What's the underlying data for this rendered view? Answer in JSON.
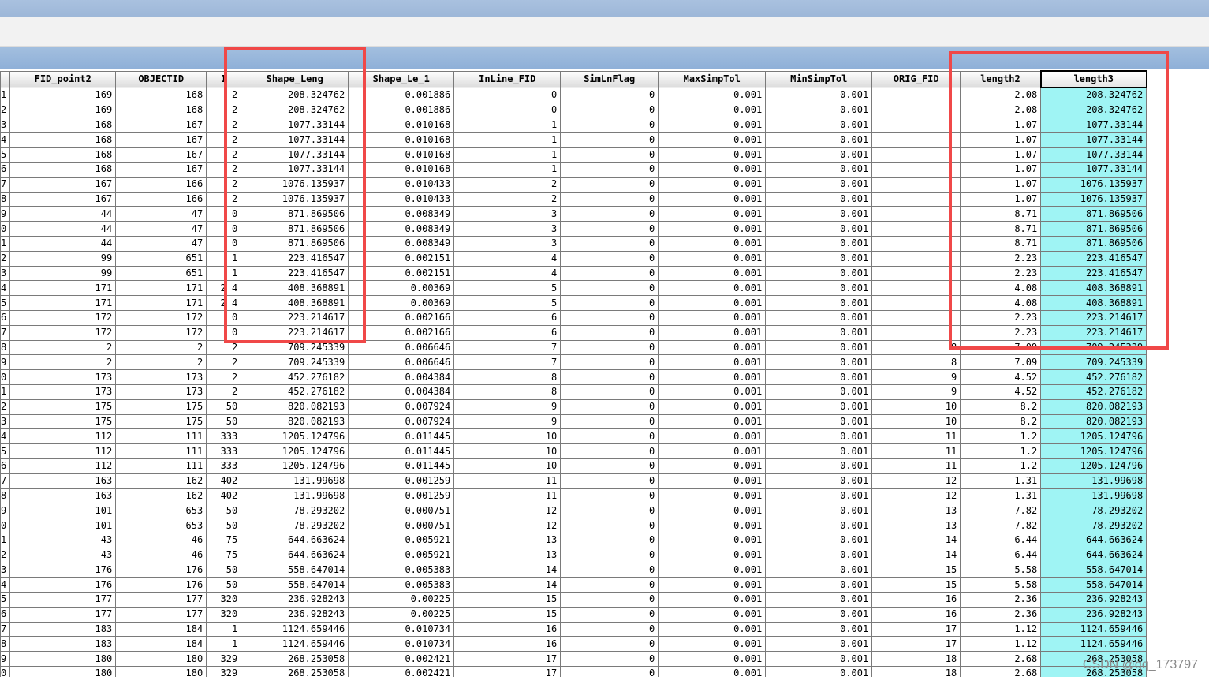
{
  "columns": [
    {
      "key": "rid",
      "label": ""
    },
    {
      "key": "fid_point2",
      "label": "FID_point2"
    },
    {
      "key": "objectid",
      "label": "OBJECTID"
    },
    {
      "key": "id",
      "label": "I"
    },
    {
      "key": "shape_leng",
      "label": "Shape_Leng"
    },
    {
      "key": "shape_le_1",
      "label": "Shape_Le_1"
    },
    {
      "key": "inline_fid",
      "label": "InLine_FID"
    },
    {
      "key": "simlnflag",
      "label": "SimLnFlag"
    },
    {
      "key": "maxsimptol",
      "label": "MaxSimpTol"
    },
    {
      "key": "minsimptol",
      "label": "MinSimpTol"
    },
    {
      "key": "orig_fid",
      "label": "ORIG_FID"
    },
    {
      "key": "length2",
      "label": "length2"
    },
    {
      "key": "length3",
      "label": "length3"
    }
  ],
  "rows": [
    [
      "1",
      "169",
      "168",
      "2",
      "208.324762",
      "0.001886",
      "0",
      "0",
      "0.001",
      "0.001",
      "",
      "2.08",
      "208.324762"
    ],
    [
      "2",
      "169",
      "168",
      "2",
      "208.324762",
      "0.001886",
      "0",
      "0",
      "0.001",
      "0.001",
      "",
      "2.08",
      "208.324762"
    ],
    [
      "3",
      "168",
      "167",
      "2",
      "1077.33144",
      "0.010168",
      "1",
      "0",
      "0.001",
      "0.001",
      "",
      "1.07",
      "1077.33144"
    ],
    [
      "4",
      "168",
      "167",
      "2",
      "1077.33144",
      "0.010168",
      "1",
      "0",
      "0.001",
      "0.001",
      "",
      "1.07",
      "1077.33144"
    ],
    [
      "5",
      "168",
      "167",
      "2",
      "1077.33144",
      "0.010168",
      "1",
      "0",
      "0.001",
      "0.001",
      "",
      "1.07",
      "1077.33144"
    ],
    [
      "6",
      "168",
      "167",
      "2",
      "1077.33144",
      "0.010168",
      "1",
      "0",
      "0.001",
      "0.001",
      "",
      "1.07",
      "1077.33144"
    ],
    [
      "7",
      "167",
      "166",
      "2",
      "1076.135937",
      "0.010433",
      "2",
      "0",
      "0.001",
      "0.001",
      "",
      "1.07",
      "1076.135937"
    ],
    [
      "8",
      "167",
      "166",
      "2",
      "1076.135937",
      "0.010433",
      "2",
      "0",
      "0.001",
      "0.001",
      "",
      "1.07",
      "1076.135937"
    ],
    [
      "9",
      "44",
      "47",
      "0",
      "871.869506",
      "0.008349",
      "3",
      "0",
      "0.001",
      "0.001",
      "",
      "8.71",
      "871.869506"
    ],
    [
      "0",
      "44",
      "47",
      "0",
      "871.869506",
      "0.008349",
      "3",
      "0",
      "0.001",
      "0.001",
      "",
      "8.71",
      "871.869506"
    ],
    [
      "1",
      "44",
      "47",
      "0",
      "871.869506",
      "0.008349",
      "3",
      "0",
      "0.001",
      "0.001",
      "",
      "8.71",
      "871.869506"
    ],
    [
      "2",
      "99",
      "651",
      "1",
      "223.416547",
      "0.002151",
      "4",
      "0",
      "0.001",
      "0.001",
      "",
      "2.23",
      "223.416547"
    ],
    [
      "3",
      "99",
      "651",
      "1",
      "223.416547",
      "0.002151",
      "4",
      "0",
      "0.001",
      "0.001",
      "",
      "2.23",
      "223.416547"
    ],
    [
      "4",
      "171",
      "171",
      "2 4",
      "408.368891",
      "0.00369",
      "5",
      "0",
      "0.001",
      "0.001",
      "",
      "4.08",
      "408.368891"
    ],
    [
      "5",
      "171",
      "171",
      "2 4",
      "408.368891",
      "0.00369",
      "5",
      "0",
      "0.001",
      "0.001",
      "",
      "4.08",
      "408.368891"
    ],
    [
      "6",
      "172",
      "172",
      "0",
      "223.214617",
      "0.002166",
      "6",
      "0",
      "0.001",
      "0.001",
      "",
      "2.23",
      "223.214617"
    ],
    [
      "7",
      "172",
      "172",
      "0",
      "223.214617",
      "0.002166",
      "6",
      "0",
      "0.001",
      "0.001",
      "",
      "2.23",
      "223.214617"
    ],
    [
      "8",
      "2",
      "2",
      "2",
      "709.245339",
      "0.006646",
      "7",
      "0",
      "0.001",
      "0.001",
      "8",
      "7.09",
      "709.245339"
    ],
    [
      "9",
      "2",
      "2",
      "2",
      "709.245339",
      "0.006646",
      "7",
      "0",
      "0.001",
      "0.001",
      "8",
      "7.09",
      "709.245339"
    ],
    [
      "0",
      "173",
      "173",
      "2",
      "452.276182",
      "0.004384",
      "8",
      "0",
      "0.001",
      "0.001",
      "9",
      "4.52",
      "452.276182"
    ],
    [
      "1",
      "173",
      "173",
      "2",
      "452.276182",
      "0.004384",
      "8",
      "0",
      "0.001",
      "0.001",
      "9",
      "4.52",
      "452.276182"
    ],
    [
      "2",
      "175",
      "175",
      "50",
      "820.082193",
      "0.007924",
      "9",
      "0",
      "0.001",
      "0.001",
      "10",
      "8.2",
      "820.082193"
    ],
    [
      "3",
      "175",
      "175",
      "50",
      "820.082193",
      "0.007924",
      "9",
      "0",
      "0.001",
      "0.001",
      "10",
      "8.2",
      "820.082193"
    ],
    [
      "4",
      "112",
      "111",
      "333",
      "1205.124796",
      "0.011445",
      "10",
      "0",
      "0.001",
      "0.001",
      "11",
      "1.2",
      "1205.124796"
    ],
    [
      "5",
      "112",
      "111",
      "333",
      "1205.124796",
      "0.011445",
      "10",
      "0",
      "0.001",
      "0.001",
      "11",
      "1.2",
      "1205.124796"
    ],
    [
      "6",
      "112",
      "111",
      "333",
      "1205.124796",
      "0.011445",
      "10",
      "0",
      "0.001",
      "0.001",
      "11",
      "1.2",
      "1205.124796"
    ],
    [
      "7",
      "163",
      "162",
      "402",
      "131.99698",
      "0.001259",
      "11",
      "0",
      "0.001",
      "0.001",
      "12",
      "1.31",
      "131.99698"
    ],
    [
      "8",
      "163",
      "162",
      "402",
      "131.99698",
      "0.001259",
      "11",
      "0",
      "0.001",
      "0.001",
      "12",
      "1.31",
      "131.99698"
    ],
    [
      "9",
      "101",
      "653",
      "50",
      "78.293202",
      "0.000751",
      "12",
      "0",
      "0.001",
      "0.001",
      "13",
      "7.82",
      "78.293202"
    ],
    [
      "0",
      "101",
      "653",
      "50",
      "78.293202",
      "0.000751",
      "12",
      "0",
      "0.001",
      "0.001",
      "13",
      "7.82",
      "78.293202"
    ],
    [
      "1",
      "43",
      "46",
      "75",
      "644.663624",
      "0.005921",
      "13",
      "0",
      "0.001",
      "0.001",
      "14",
      "6.44",
      "644.663624"
    ],
    [
      "2",
      "43",
      "46",
      "75",
      "644.663624",
      "0.005921",
      "13",
      "0",
      "0.001",
      "0.001",
      "14",
      "6.44",
      "644.663624"
    ],
    [
      "3",
      "176",
      "176",
      "50",
      "558.647014",
      "0.005383",
      "14",
      "0",
      "0.001",
      "0.001",
      "15",
      "5.58",
      "558.647014"
    ],
    [
      "4",
      "176",
      "176",
      "50",
      "558.647014",
      "0.005383",
      "14",
      "0",
      "0.001",
      "0.001",
      "15",
      "5.58",
      "558.647014"
    ],
    [
      "5",
      "177",
      "177",
      "320",
      "236.928243",
      "0.00225",
      "15",
      "0",
      "0.001",
      "0.001",
      "16",
      "2.36",
      "236.928243"
    ],
    [
      "6",
      "177",
      "177",
      "320",
      "236.928243",
      "0.00225",
      "15",
      "0",
      "0.001",
      "0.001",
      "16",
      "2.36",
      "236.928243"
    ],
    [
      "7",
      "183",
      "184",
      "1",
      "1124.659446",
      "0.010734",
      "16",
      "0",
      "0.001",
      "0.001",
      "17",
      "1.12",
      "1124.659446"
    ],
    [
      "8",
      "183",
      "184",
      "1",
      "1124.659446",
      "0.010734",
      "16",
      "0",
      "0.001",
      "0.001",
      "17",
      "1.12",
      "1124.659446"
    ],
    [
      "9",
      "180",
      "180",
      "329",
      "268.253058",
      "0.002421",
      "17",
      "0",
      "0.001",
      "0.001",
      "18",
      "2.68",
      "268.253058"
    ],
    [
      "0",
      "180",
      "180",
      "329",
      "268.253058",
      "0.002421",
      "17",
      "0",
      "0.001",
      "0.001",
      "18",
      "2.68",
      "268.253058"
    ]
  ],
  "watermark": "CSDN @qq_173797",
  "colors": {
    "highlight_box": "#f04848",
    "length3_fill": "#9ff4f4"
  }
}
